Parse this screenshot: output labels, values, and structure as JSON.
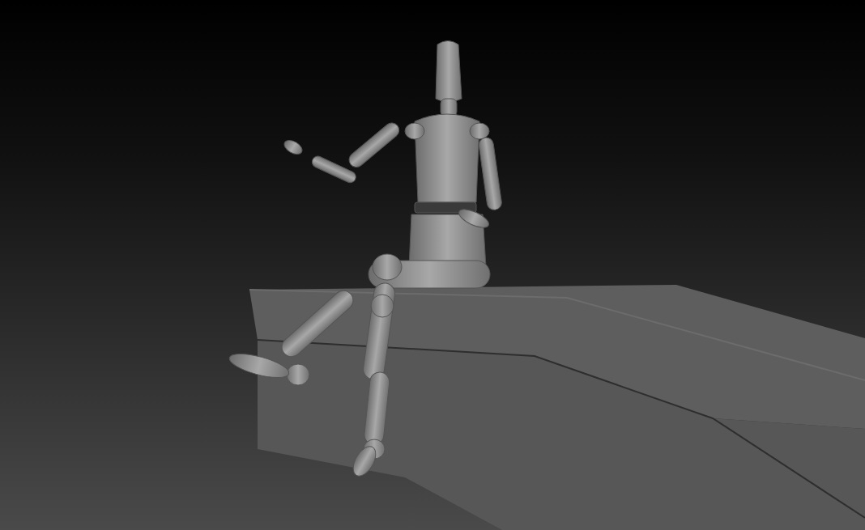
{
  "viewport": {
    "kind": "render"
  }
}
